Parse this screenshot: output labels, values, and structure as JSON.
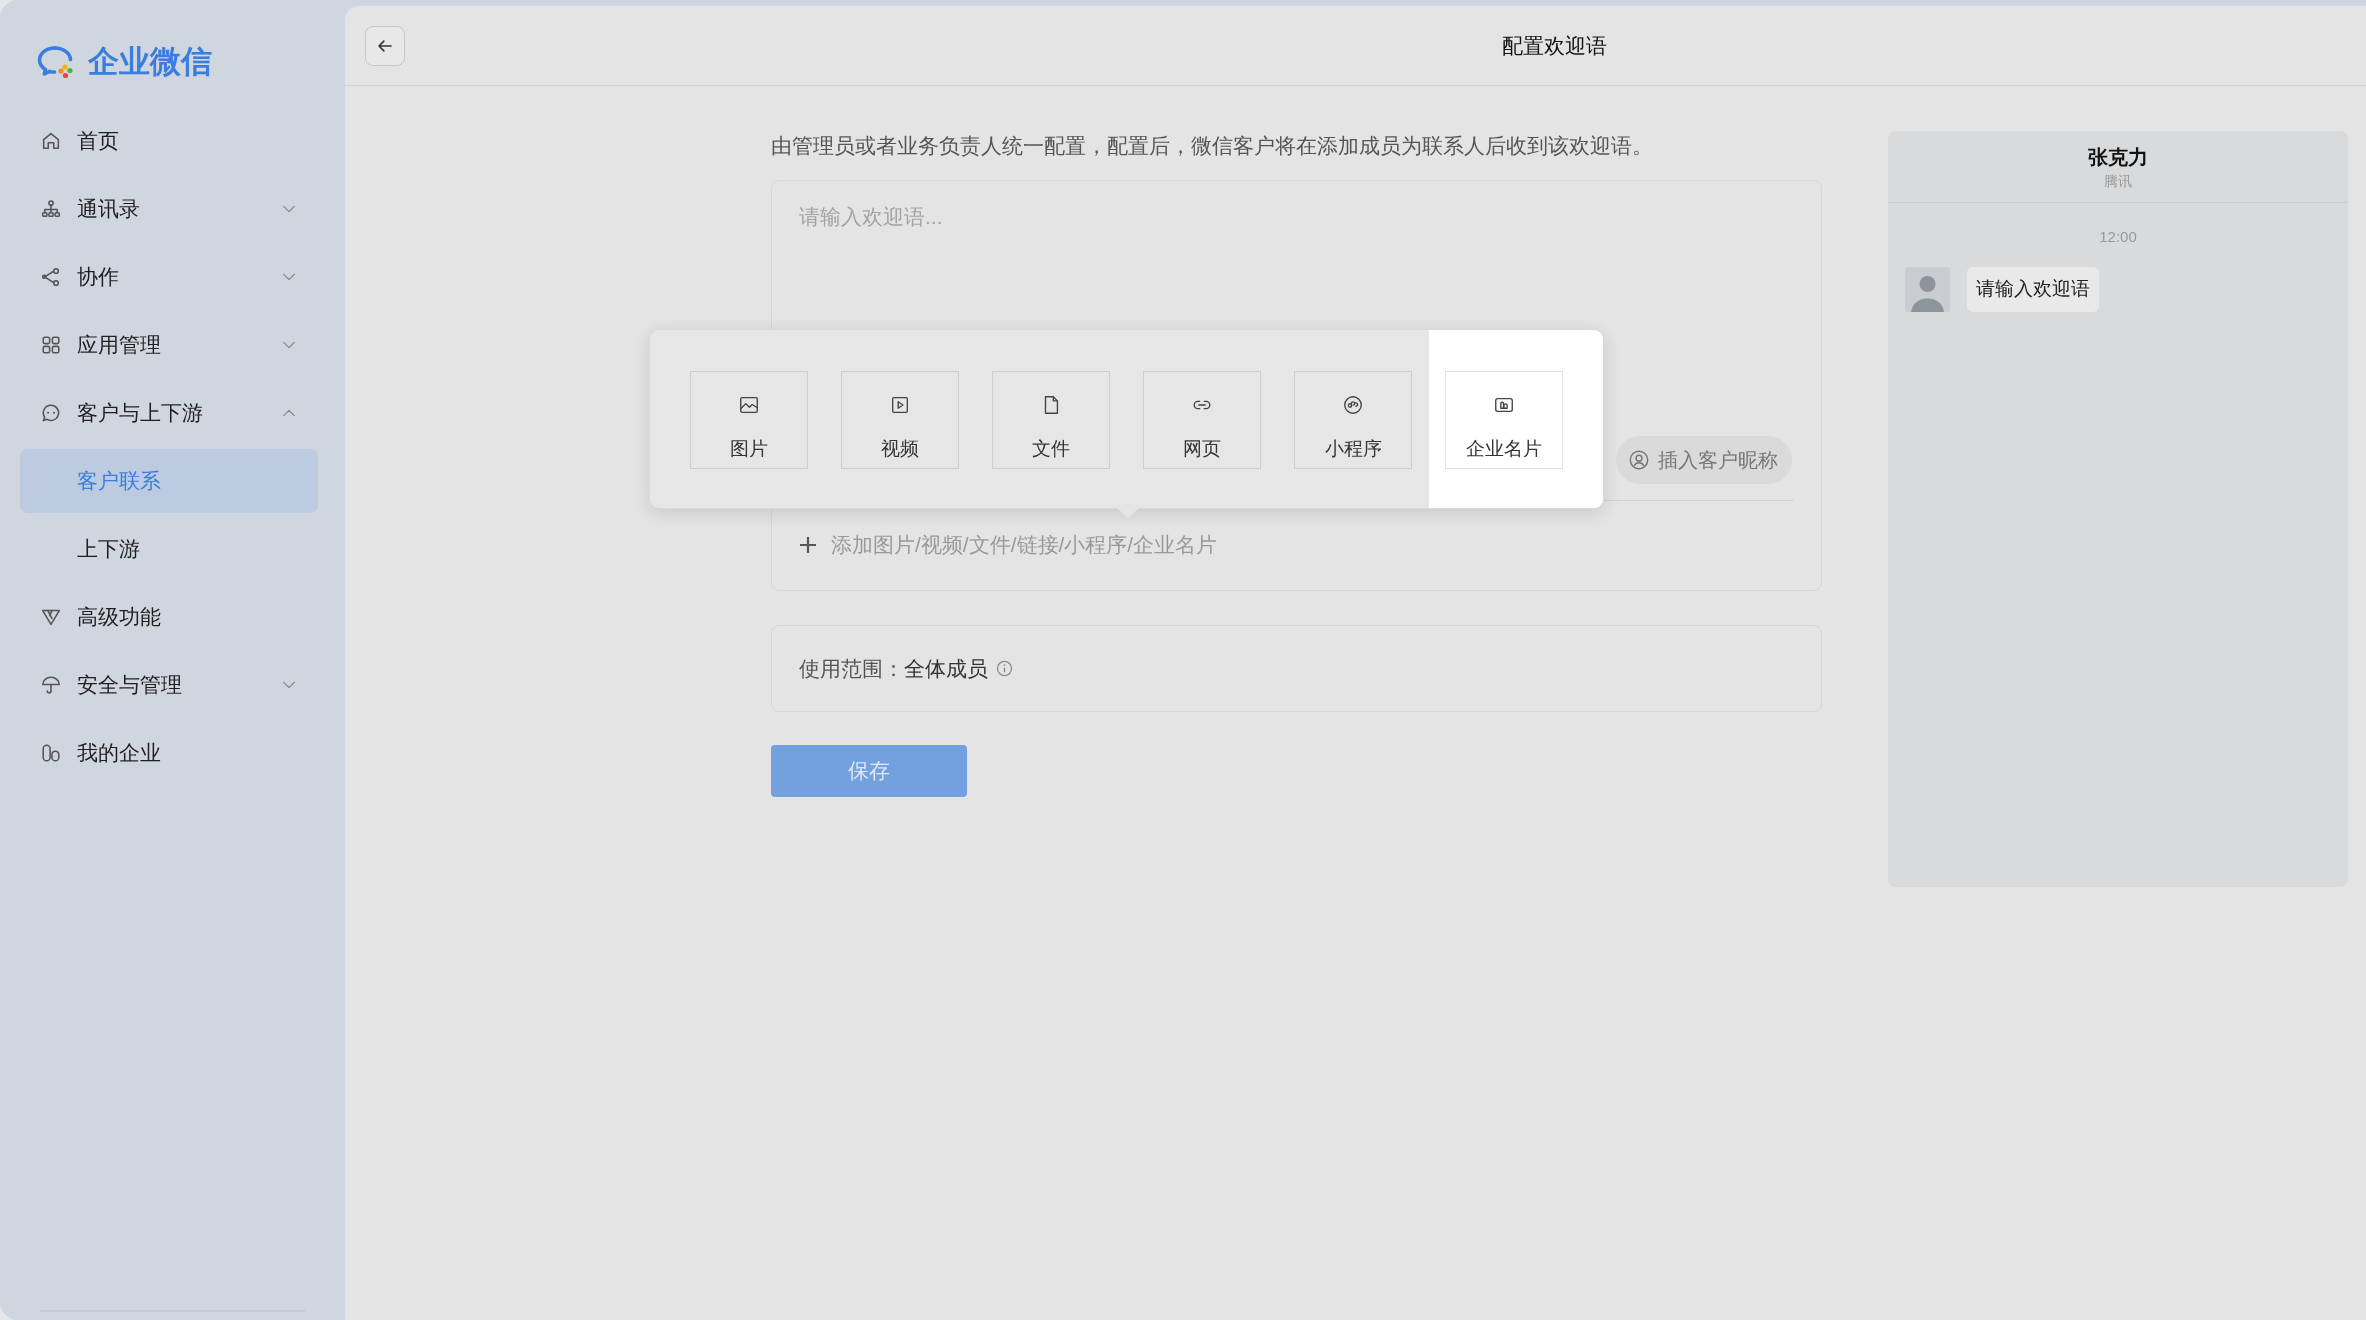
{
  "sidebar": {
    "logo": {
      "text": "企业微信"
    },
    "items": [
      {
        "label": "首页",
        "kind": "link",
        "selected": false
      },
      {
        "label": "通讯录",
        "kind": "group",
        "expanded": false,
        "selected": false
      },
      {
        "label": "协作",
        "kind": "group",
        "expanded": false,
        "selected": false
      },
      {
        "label": "应用管理",
        "kind": "group",
        "expanded": false,
        "selected": false
      },
      {
        "label": "客户与上下游",
        "kind": "group",
        "expanded": true,
        "selected": false,
        "children": [
          {
            "label": "客户联系",
            "selected": true
          },
          {
            "label": "上下游",
            "selected": false
          }
        ]
      },
      {
        "label": "高级功能",
        "kind": "link",
        "selected": false
      },
      {
        "label": "安全与管理",
        "kind": "group",
        "expanded": false,
        "selected": false
      },
      {
        "label": "我的企业",
        "kind": "link",
        "selected": false
      }
    ]
  },
  "header": {
    "title": "配置欢迎语"
  },
  "form": {
    "description": "由管理员或者业务负责人统一配置，配置后，微信客户将在添加成员为联系人后收到该欢迎语。",
    "editor": {
      "placeholder": "请输入欢迎语...",
      "insert_nickname_button": "插入客户昵称",
      "add_attachment_button": "添加图片/视频/文件/链接/小程序/企业名片"
    },
    "attachment_popup": {
      "items": [
        {
          "label": "图片",
          "highlighted": false
        },
        {
          "label": "视频",
          "highlighted": false
        },
        {
          "label": "文件",
          "highlighted": false
        },
        {
          "label": "网页",
          "highlighted": false
        },
        {
          "label": "小程序",
          "highlighted": false
        },
        {
          "label": "企业名片",
          "highlighted": true
        }
      ]
    },
    "scope": {
      "label": "使用范围：",
      "value": "全体成员"
    },
    "save_button": "保存"
  },
  "preview": {
    "contact_name": "张克力",
    "company": "腾讯",
    "time": "12:00",
    "message": "请输入欢迎语"
  }
}
